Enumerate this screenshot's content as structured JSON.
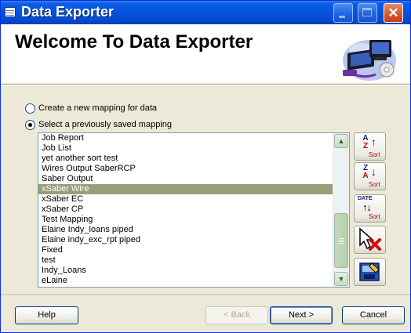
{
  "window": {
    "title": "Data Exporter",
    "controls": {
      "minimize_icon": "minimize-icon",
      "maximize_icon": "maximize-icon",
      "close_glyph": "✕"
    }
  },
  "header": {
    "title": "Welcome To Data Exporter",
    "logo_icon": "computer-wizard-icon"
  },
  "options": {
    "create_new": {
      "label": "Create a new mapping for data",
      "checked": false
    },
    "select_saved": {
      "label": "Select a previously saved mapping",
      "checked": true
    }
  },
  "mappings": {
    "items": [
      "Job Report",
      "Job List",
      "yet another sort test",
      "Wires Output SaberRCP",
      "Saber Output",
      "xSaber Wire",
      "xSaber EC",
      "xSaber CP",
      "Test Mapping",
      "Elaine Indy_loans piped",
      "Elaine indy_exc_rpt piped",
      "Fixed",
      "test",
      "Indy_Loans",
      "eLaine"
    ],
    "selected": "xSaber Wire",
    "selected_color": "#95a07b"
  },
  "scrollbar": {
    "up_glyph": "▲",
    "down_glyph": "▼",
    "scroll_position": 0.85
  },
  "side_buttons": {
    "sort_az": {
      "top": "A",
      "bottom": "Z",
      "arrow": "↑",
      "label": "Sort"
    },
    "sort_za": {
      "top": "Z",
      "bottom": "A",
      "arrow": "↓",
      "label": "Sort"
    },
    "sort_date": {
      "date_label": "DATE",
      "arrows": "↑↓",
      "label": "Sort"
    },
    "delete_icon": "delete-mapping-icon",
    "edit_icon": "edit-mapping-icon"
  },
  "footer": {
    "help": "Help",
    "back": "< Back",
    "next": "Next >",
    "cancel": "Cancel"
  }
}
